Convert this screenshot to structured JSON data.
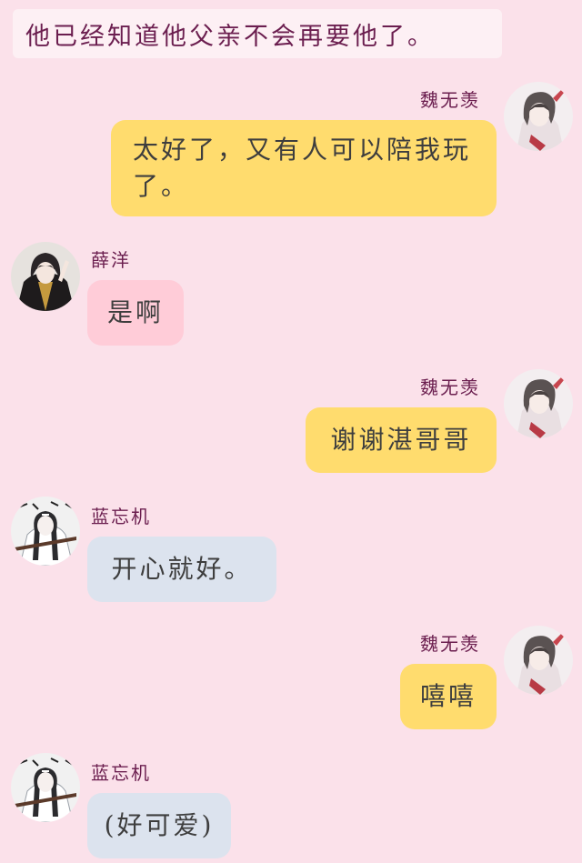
{
  "narration": "他已经知道他父亲不会再要他了。",
  "messages": [
    {
      "speaker": "魏无羡",
      "text": "太好了，又有人可以陪我玩了。",
      "avatar_icon": "wei-wuxian-avatar-icon",
      "bubble_color": "#ffdc6e",
      "side": "right"
    },
    {
      "speaker": "薛洋",
      "text": "是啊",
      "avatar_icon": "xue-yang-avatar-icon",
      "bubble_color": "#ffccd8",
      "side": "left"
    },
    {
      "speaker": "魏无羡",
      "text": "谢谢湛哥哥",
      "avatar_icon": "wei-wuxian-avatar-icon",
      "bubble_color": "#ffdc6e",
      "side": "right"
    },
    {
      "speaker": "蓝忘机",
      "text": "开心就好。",
      "avatar_icon": "lan-wangji-avatar-icon",
      "bubble_color": "#dce3ee",
      "side": "left"
    },
    {
      "speaker": "魏无羡",
      "text": "嘻嘻",
      "avatar_icon": "wei-wuxian-avatar-icon",
      "bubble_color": "#ffdc6e",
      "side": "right"
    },
    {
      "speaker": "蓝忘机",
      "text": "(好可爱)",
      "avatar_icon": "lan-wangji-avatar-icon",
      "bubble_color": "#dce3ee",
      "side": "left"
    }
  ],
  "colors": {
    "background": "#fbe1ea",
    "name_text": "#6b1e4f",
    "narration_bg": "#fdf0f4"
  }
}
